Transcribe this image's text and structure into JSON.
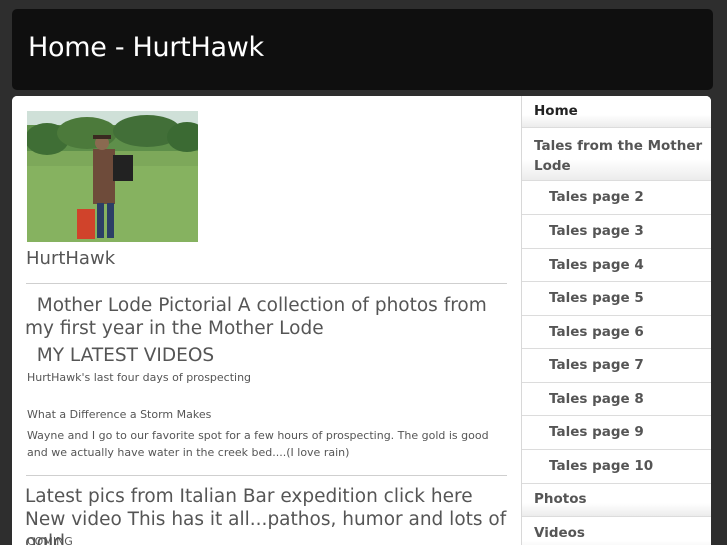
{
  "header": {
    "title": "Home - HurtHawk"
  },
  "content": {
    "site_name": "HurtHawk",
    "pictorial_title": "  Mother Lode Pictorial A collection of photos from my first year in the Mother Lode",
    "videos_heading": "  MY LATEST VIDEOS",
    "video1": "HurtHawk's last four days of prospecting",
    "video2": "What a Difference a Storm Makes",
    "video2_desc": "Wayne and I go to our favorite spot for a few hours of prospecting. The gold is good and we actually have water in the creek bed....(I love rain)",
    "italian_bar": "Latest pics from Italian Bar expedition click here New video This has it all...pathos, humor and lots of gold",
    "coming": "COMING"
  },
  "nav": {
    "home": "Home",
    "tales": "Tales from the Mother Lode",
    "pages": [
      "Tales page 2",
      "Tales page 3",
      "Tales page 4",
      "Tales page 5",
      "Tales page 6",
      "Tales page 7",
      "Tales page 8",
      "Tales page 9",
      "Tales page 10"
    ],
    "photos": "Photos",
    "videos": "Videos"
  }
}
